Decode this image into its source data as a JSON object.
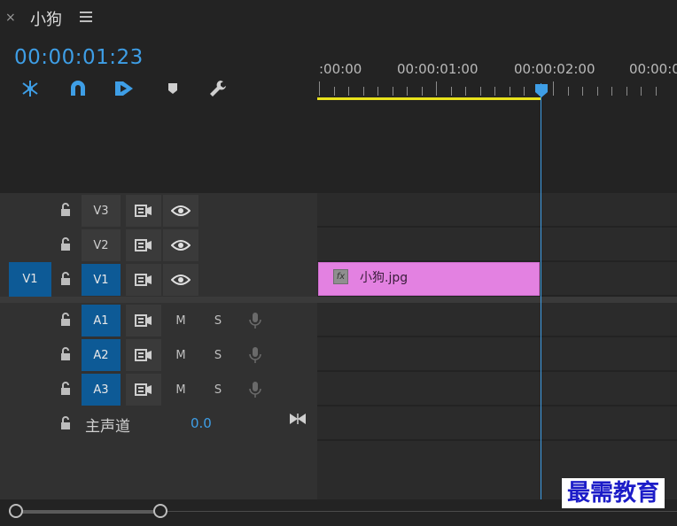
{
  "panel": {
    "close_label": "×",
    "sequence_name": "小狗",
    "timecode": "00:00:01:23"
  },
  "tools": [
    {
      "name": "ripple-edit-icon"
    },
    {
      "name": "snap-magnet-icon"
    },
    {
      "name": "linked-selection-icon"
    },
    {
      "name": "add-marker-icon"
    },
    {
      "name": "wrench-settings-icon"
    }
  ],
  "ruler": {
    "labels": [
      ":00:00",
      "00:00:01:00",
      "00:00:02:00",
      "00:00:0"
    ]
  },
  "tracks": {
    "video": [
      {
        "label": "V3",
        "active": false,
        "source": ""
      },
      {
        "label": "V2",
        "active": false,
        "source": ""
      },
      {
        "label": "V1",
        "active": true,
        "source": "V1"
      }
    ],
    "audio": [
      {
        "label": "A1",
        "mute": "M",
        "solo": "S"
      },
      {
        "label": "A2",
        "mute": "M",
        "solo": "S"
      },
      {
        "label": "A3",
        "mute": "M",
        "solo": "S"
      }
    ],
    "master": {
      "label": "主声道",
      "value": "0.0"
    }
  },
  "clip": {
    "fx": "fx",
    "name": "小狗.jpg",
    "color": "#e381e1"
  },
  "colors": {
    "accent": "#3e9ee6",
    "work_area": "#e8e21c",
    "active_track": "#0d5a96"
  },
  "watermark": "最需教育"
}
